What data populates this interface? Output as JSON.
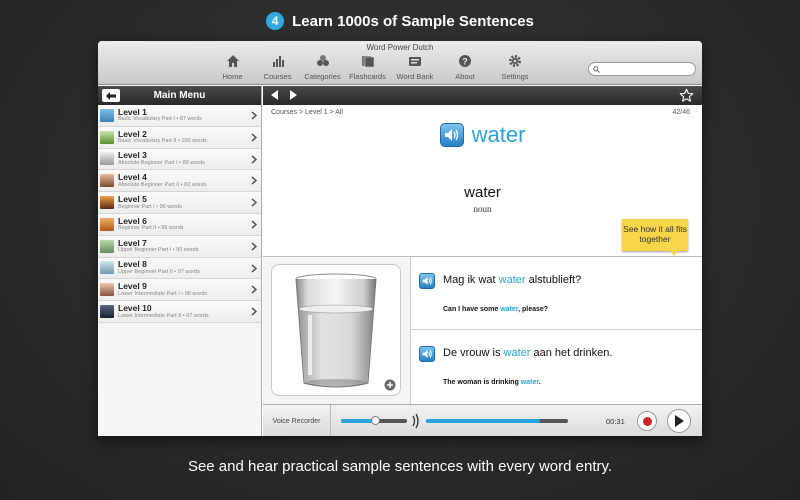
{
  "promo": {
    "step_number": "4",
    "title": "Learn 1000s of Sample Sentences",
    "caption": "See and hear practical sample sentences with every word entry."
  },
  "window": {
    "title": "Word Power Dutch"
  },
  "toolbar": {
    "items": [
      {
        "label": "Home",
        "icon": "home-icon"
      },
      {
        "label": "Courses",
        "icon": "bar-chart-icon"
      },
      {
        "label": "Categories",
        "icon": "categories-icon"
      },
      {
        "label": "Flashcards",
        "icon": "flashcards-icon"
      },
      {
        "label": "Word Bank",
        "icon": "word-bank-icon"
      },
      {
        "label": "About",
        "icon": "question-icon"
      },
      {
        "label": "Settings",
        "icon": "gear-icon"
      }
    ],
    "search_placeholder": ""
  },
  "sidebar": {
    "title": "Main Menu",
    "levels": [
      {
        "name": "Level 1",
        "sub": "Basic Vocabulary Part I • 87 words"
      },
      {
        "name": "Level 2",
        "sub": "Basic Vocabulary Part II • 100 words"
      },
      {
        "name": "Level 3",
        "sub": "Absolute Beginner Part I • 89 words"
      },
      {
        "name": "Level 4",
        "sub": "Absolute Beginner Part II • 82 words"
      },
      {
        "name": "Level 5",
        "sub": "Beginner Part I • 96 words"
      },
      {
        "name": "Level 6",
        "sub": "Beginner Part II • 99 words"
      },
      {
        "name": "Level 7",
        "sub": "Upper Beginner Part I • 90 words"
      },
      {
        "name": "Level 8",
        "sub": "Upper Beginner Part II • 97 words"
      },
      {
        "name": "Level 9",
        "sub": "Lower Intermediate Part I • 98 words"
      },
      {
        "name": "Level 10",
        "sub": "Lower Intermediate Part II • 97 words"
      }
    ]
  },
  "entry": {
    "breadcrumb": "Courses > Level 1 > All",
    "counter": "42/46",
    "headword": "water",
    "word": "water",
    "part_of_speech": "noun",
    "tip": "See how it all fits together"
  },
  "sentences": [
    {
      "dutch_before": "Mag ik wat ",
      "dutch_highlight": "water",
      "dutch_after": " alstublieft?",
      "english_before": "Can I have some ",
      "english_highlight": "water",
      "english_after": ", please?"
    },
    {
      "dutch_before": "De vrouw is ",
      "dutch_highlight": "water",
      "dutch_after": " aan het drinken.",
      "english_before": "The woman is drinking ",
      "english_highlight": "water",
      "english_after": "."
    }
  ],
  "player": {
    "voice_recorder_label": "Voice Recorder",
    "time": "00:31",
    "volume_level": 0.52,
    "progress": 0.8
  },
  "colors": {
    "accent": "#2ba3dc",
    "record": "#d0232a",
    "tip": "#f7d64a"
  }
}
